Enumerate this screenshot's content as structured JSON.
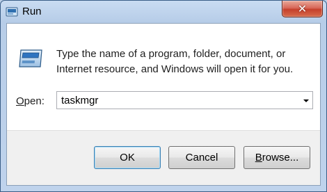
{
  "window": {
    "title": "Run",
    "close_glyph": "✕",
    "title_icon": "run-app-icon"
  },
  "dialog": {
    "icon": "run-icon",
    "message_line1": "Type the name of a program, folder, document, or",
    "message_line2": "Internet resource, and Windows will open it for you.",
    "open_label_accel": "O",
    "open_label_rest": "pen:",
    "open_value": "taskmgr"
  },
  "buttons": {
    "ok_label": "OK",
    "cancel_label": "Cancel",
    "browse_accel": "B",
    "browse_rest": "rowse..."
  },
  "colors": {
    "frame": "#bcd0e8",
    "close_button": "#c5402c",
    "default_button_border": "#3c7fb1"
  }
}
